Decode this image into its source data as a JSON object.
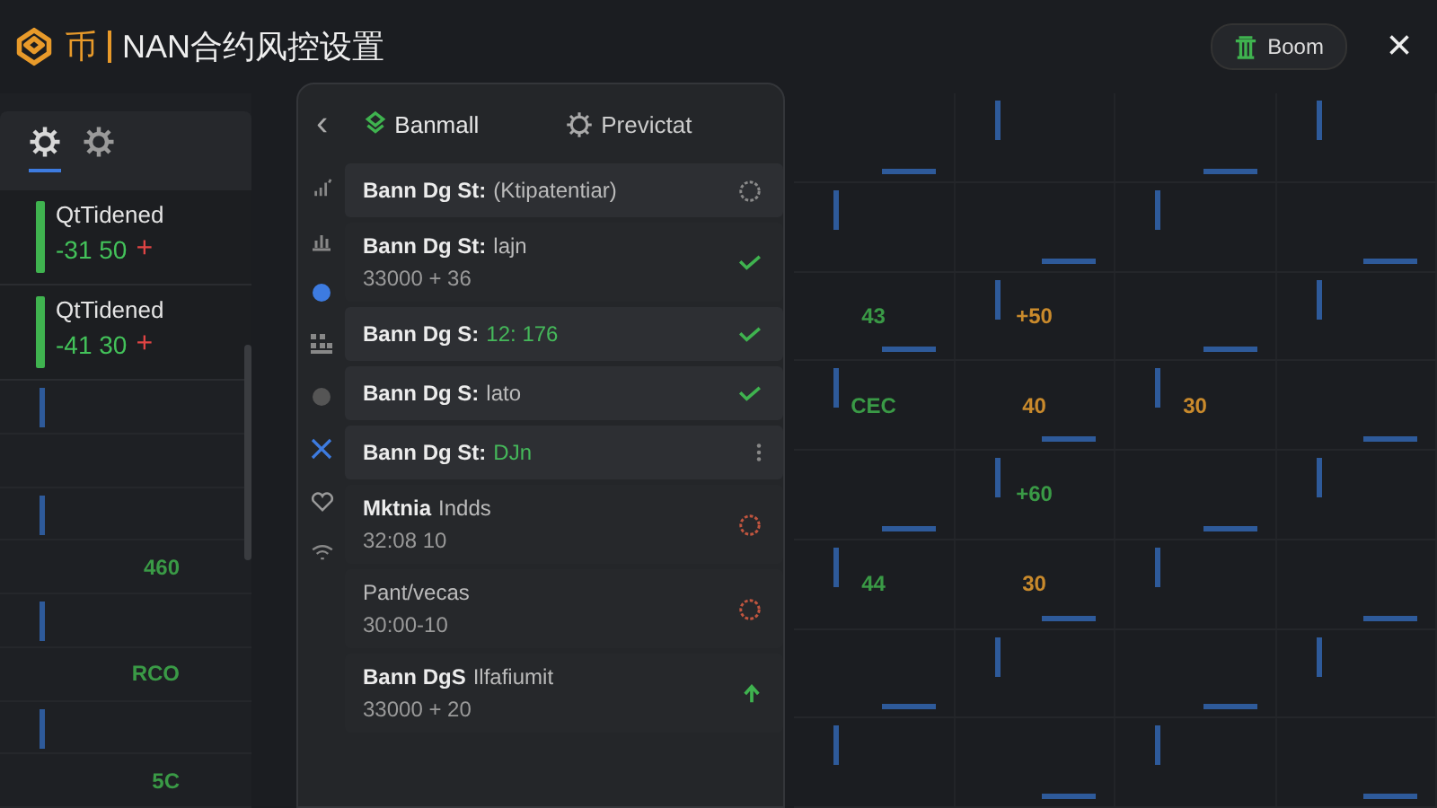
{
  "header": {
    "brand_mark": "币",
    "title": "NAN合约风控设置",
    "account_button": "Boom",
    "close": "×"
  },
  "left_panel": {
    "tabs": [
      {
        "selected": true
      },
      {
        "selected": false
      }
    ],
    "cards": [
      {
        "label": "QtTidened",
        "value": "-31 50",
        "sign": "+"
      },
      {
        "label": "QtTidened",
        "value": "-41 30",
        "sign": "+"
      }
    ]
  },
  "background_values": [
    {
      "text": "460",
      "color": "#3a9a46"
    },
    {
      "text": "RCO",
      "color": "#3a9a46"
    },
    {
      "text": "5C",
      "color": "#3a9a46"
    },
    {
      "text": "43",
      "color": "#3a9a46"
    },
    {
      "text": "+50",
      "color": "#c98a2c"
    },
    {
      "text": "CEC",
      "color": "#3a9a46"
    },
    {
      "text": "40",
      "color": "#c98a2c"
    },
    {
      "text": "30",
      "color": "#c98a2c"
    },
    {
      "text": "+60",
      "color": "#3a9a46"
    },
    {
      "text": "44",
      "color": "#3a9a46"
    },
    {
      "text": "30",
      "color": "#c98a2c"
    }
  ],
  "panel": {
    "back": "‹",
    "tabs": [
      {
        "label": "Banmall",
        "selected": true
      },
      {
        "label": "Previctat",
        "selected": false
      }
    ],
    "items": [
      {
        "title": "Bann Dg St:",
        "value": "(Ktipatentiar)",
        "kind": "pending",
        "positive": false
      },
      {
        "title": "Bann Dg St:",
        "value": "lajn",
        "sub": "33000 + 36",
        "kind": "done",
        "positive": false
      },
      {
        "title": "Bann Dg S:",
        "value": "12: 176",
        "kind": "done",
        "positive": true
      },
      {
        "title": "Bann Dg S:",
        "value": "lato",
        "kind": "done",
        "positive": false
      },
      {
        "title": "Bann Dg St:",
        "value": "DJn",
        "kind": "more",
        "positive": true
      },
      {
        "title": "Mktnia",
        "value": "Indds",
        "sub": "32:08 10",
        "kind": "alert",
        "positive": false
      },
      {
        "value": "Pant/vecas",
        "sub": "30:00-10",
        "kind": "alert",
        "positive": false
      },
      {
        "title": "Bann DgS",
        "value": "Ilfafiumit",
        "sub": "33000 + 20",
        "kind": "up",
        "positive": false
      }
    ]
  }
}
